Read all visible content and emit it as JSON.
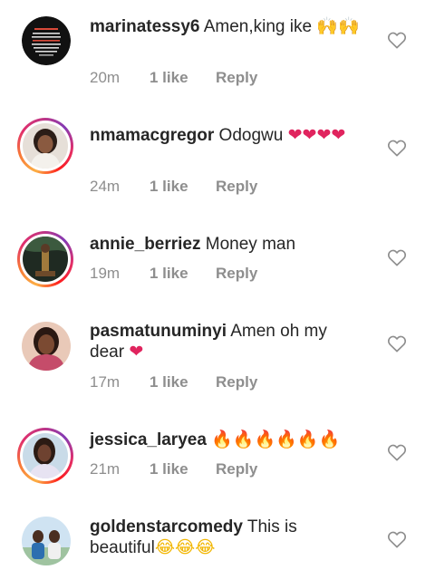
{
  "comments": [
    {
      "username": "marinatessy6",
      "text": " Amen,king ike",
      "emoji": "🙌🙌",
      "time": "20m",
      "likes": "1 like",
      "reply": "Reply"
    },
    {
      "username": "nmamacgregor",
      "text": " Odogwu ",
      "emoji": "❤❤❤❤",
      "time": "24m",
      "likes": "1 like",
      "reply": "Reply"
    },
    {
      "username": "annie_berriez",
      "text": " Money man",
      "emoji": "",
      "time": "19m",
      "likes": "1 like",
      "reply": "Reply"
    },
    {
      "username": "pasmatunuminyi",
      "text": " Amen oh my dear ",
      "emoji": "❤",
      "time": "17m",
      "likes": "1 like",
      "reply": "Reply"
    },
    {
      "username": "jessica_laryea",
      "text": " ",
      "emoji": "🔥🔥🔥🔥🔥🔥",
      "time": "21m",
      "likes": "1 like",
      "reply": "Reply"
    },
    {
      "username": "goldenstarcomedy",
      "text": " This is beautiful",
      "emoji": "😂😂😂",
      "time": "",
      "likes": "",
      "reply": ""
    }
  ],
  "icons": {
    "like": "heart-outline-icon"
  },
  "colors": {
    "text": "#262626",
    "meta": "#8e8e8e",
    "heart": "#e0245e",
    "ring_start": "#fcaf45",
    "ring_end": "#c13584"
  }
}
